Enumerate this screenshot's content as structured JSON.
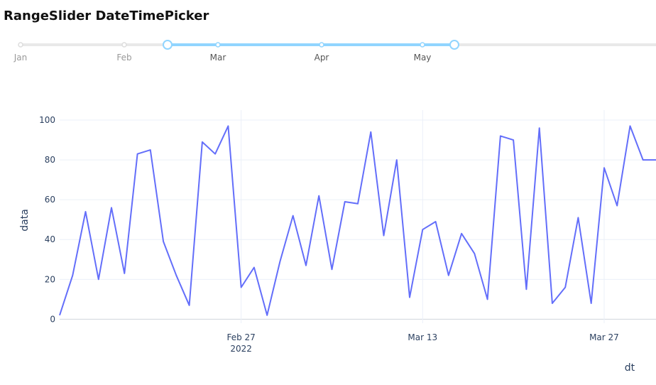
{
  "title": "RangeSlider DateTimePicker",
  "slider": {
    "marks": [
      {
        "label": "Jan",
        "in_range": false
      },
      {
        "label": "Feb",
        "in_range": false
      },
      {
        "label": "Mar",
        "in_range": true
      },
      {
        "label": "Apr",
        "in_range": true
      },
      {
        "label": "May",
        "in_range": true
      }
    ],
    "range_start": "mid-Feb",
    "range_end": "late-May",
    "colors": {
      "track": "#e9e9e9",
      "active": "#91d5ff",
      "handle": "#91d5ff",
      "mark_in": "#555555",
      "mark_out": "#999999"
    }
  },
  "chart_data": {
    "type": "line",
    "xlabel": "dt",
    "ylabel": "data",
    "ylim": [
      -2,
      105
    ],
    "xlim": [
      "2022-02-13",
      "2022-03-31"
    ],
    "x_ticks": [
      {
        "date": "2022-02-27",
        "label": "Feb 27",
        "sublabel": "2022"
      },
      {
        "date": "2022-03-13",
        "label": "Mar 13",
        "sublabel": ""
      },
      {
        "date": "2022-03-27",
        "label": "Mar 27",
        "sublabel": ""
      }
    ],
    "y_ticks": [
      0,
      20,
      40,
      60,
      80,
      100
    ],
    "grid": true,
    "line_color": "#636efa",
    "series": [
      {
        "x": [
          "2022-02-13",
          "2022-02-14",
          "2022-02-15",
          "2022-02-16",
          "2022-02-17",
          "2022-02-18",
          "2022-02-19",
          "2022-02-20",
          "2022-02-21",
          "2022-02-22",
          "2022-02-23",
          "2022-02-24",
          "2022-02-25",
          "2022-02-26",
          "2022-02-27",
          "2022-02-28",
          "2022-03-01",
          "2022-03-02",
          "2022-03-03",
          "2022-03-04",
          "2022-03-05",
          "2022-03-06",
          "2022-03-07",
          "2022-03-08",
          "2022-03-09",
          "2022-03-10",
          "2022-03-11",
          "2022-03-12",
          "2022-03-13",
          "2022-03-14",
          "2022-03-15",
          "2022-03-16",
          "2022-03-17",
          "2022-03-18",
          "2022-03-19",
          "2022-03-20",
          "2022-03-21",
          "2022-03-22",
          "2022-03-23",
          "2022-03-24",
          "2022-03-25",
          "2022-03-26",
          "2022-03-27",
          "2022-03-28",
          "2022-03-29",
          "2022-03-30",
          "2022-03-31"
        ],
        "y": [
          2,
          22,
          54,
          20,
          56,
          23,
          83,
          85,
          39,
          22,
          7,
          89,
          83,
          97,
          16,
          26,
          2,
          29,
          52,
          27,
          62,
          25,
          59,
          58,
          94,
          42,
          80,
          11,
          45,
          49,
          22,
          43,
          33,
          10,
          92,
          90,
          15,
          96,
          8,
          16,
          51,
          8,
          76,
          57,
          97,
          80,
          80
        ]
      }
    ]
  }
}
